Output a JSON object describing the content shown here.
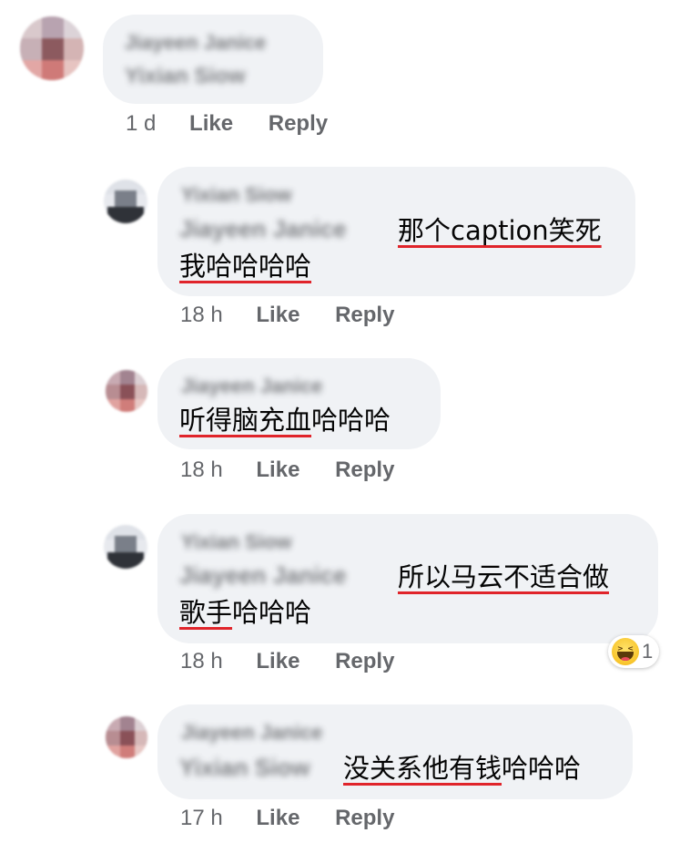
{
  "comments": [
    {
      "author": "Jiayeen Janice",
      "mention": "Yixian Siow",
      "text": "",
      "time": "1 d",
      "like": "Like",
      "reply": "Reply"
    },
    {
      "author": "Yixian Siow",
      "mention": "Jiayeen Janice",
      "text_line1": "那个caption笑死",
      "text_line2": "我哈哈哈哈",
      "time": "18 h",
      "like": "Like",
      "reply": "Reply"
    },
    {
      "author": "Jiayeen Janice",
      "text_underlined": "听得脑充血",
      "text_rest": "哈哈哈",
      "time": "18 h",
      "like": "Like",
      "reply": "Reply"
    },
    {
      "author": "Yixian Siow",
      "mention": "Jiayeen Janice",
      "text_line1": "所以马云不适合做",
      "text_line2_underlined": "歌手",
      "text_line2_rest": "哈哈哈",
      "time": "18 h",
      "like": "Like",
      "reply": "Reply",
      "reaction": {
        "icon": "haha-reaction-icon",
        "count": "1"
      }
    },
    {
      "author": "Jiayeen Janice",
      "mention": "Yixian Siow",
      "text_underlined": "没关系他有钱",
      "text_rest": "哈哈哈",
      "time": "17 h",
      "like": "Like",
      "reply": "Reply"
    }
  ],
  "colors": {
    "bubble": "#f0f2f5",
    "meta_text": "#65676b",
    "underline": "#e0242a",
    "reaction_yellow": "#f8c52c"
  }
}
